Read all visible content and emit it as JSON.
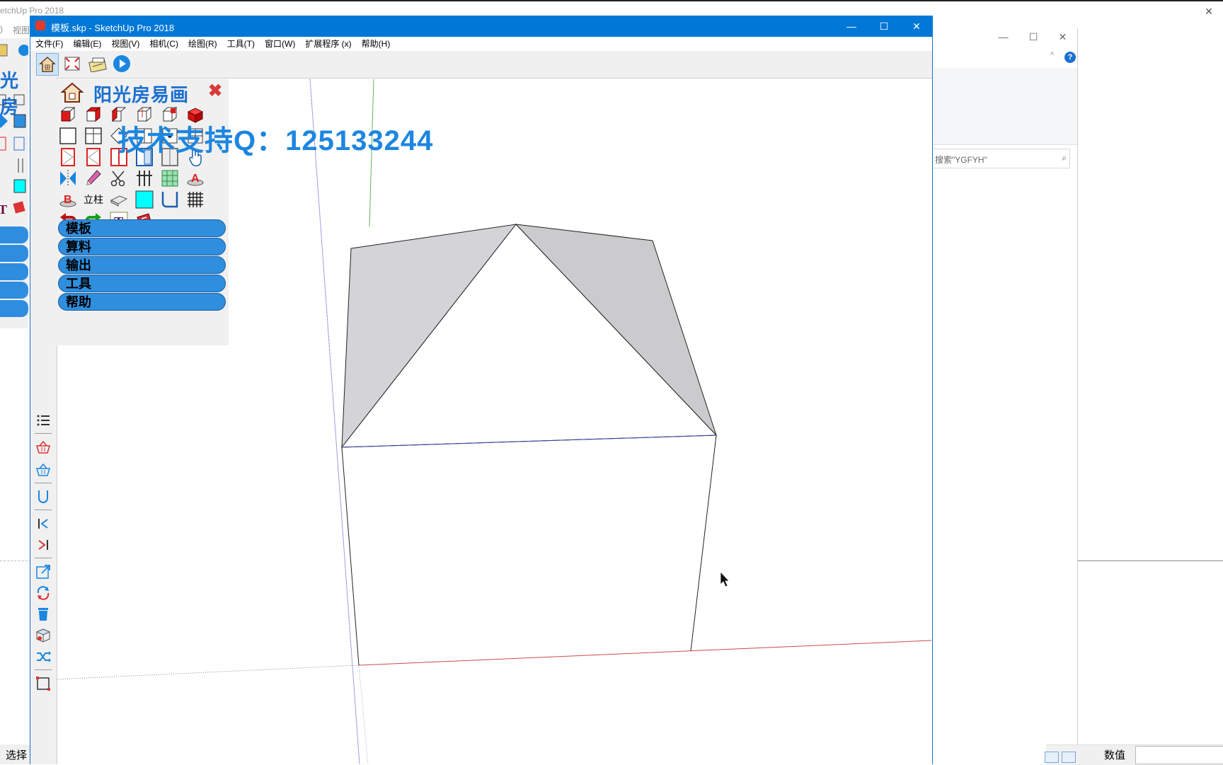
{
  "background_window": {
    "title_fragment": "etchUp Pro 2018",
    "menu_fragment": ")",
    "menu_view": "视图",
    "panel_title_fragment": "光房",
    "status_left": "选择",
    "close_glyph": "✕"
  },
  "explorer": {
    "controls": [
      "—",
      "☐",
      "✕"
    ],
    "caret": "^",
    "help": "?",
    "search_placeholder": "搜索\"YGFYH\"",
    "search_icon_glyph": "⌕"
  },
  "status_bar": {
    "value_label": "数值",
    "value": ""
  },
  "main_window": {
    "title": "模板.skp - SketchUp Pro 2018",
    "controls": [
      "—",
      "☐",
      "✕"
    ],
    "menu": [
      "文件(F)",
      "编辑(E)",
      "视图(V)",
      "相机(C)",
      "绘图(R)",
      "工具(T)",
      "窗口(W)",
      "扩展程序 (x)",
      "帮助(H)"
    ]
  },
  "toolbar": {
    "items": [
      "home-icon",
      "zoom-extents-icon",
      "ruler-pencil-icon",
      "play-icon"
    ]
  },
  "plugin": {
    "title": "阳光房易画",
    "close": "✖",
    "column_label": "立柱",
    "menu": [
      "模板",
      "算料",
      "输出",
      "工具",
      "帮助"
    ]
  },
  "watermark": "技术支持Q：125133244",
  "colors": {
    "titlebar": "#0078d7",
    "plugin_title": "#1a6fd0",
    "plugin_button": "#2f8ede",
    "watermark": "#1d86e0",
    "roof_face": "#d4d3d7"
  }
}
